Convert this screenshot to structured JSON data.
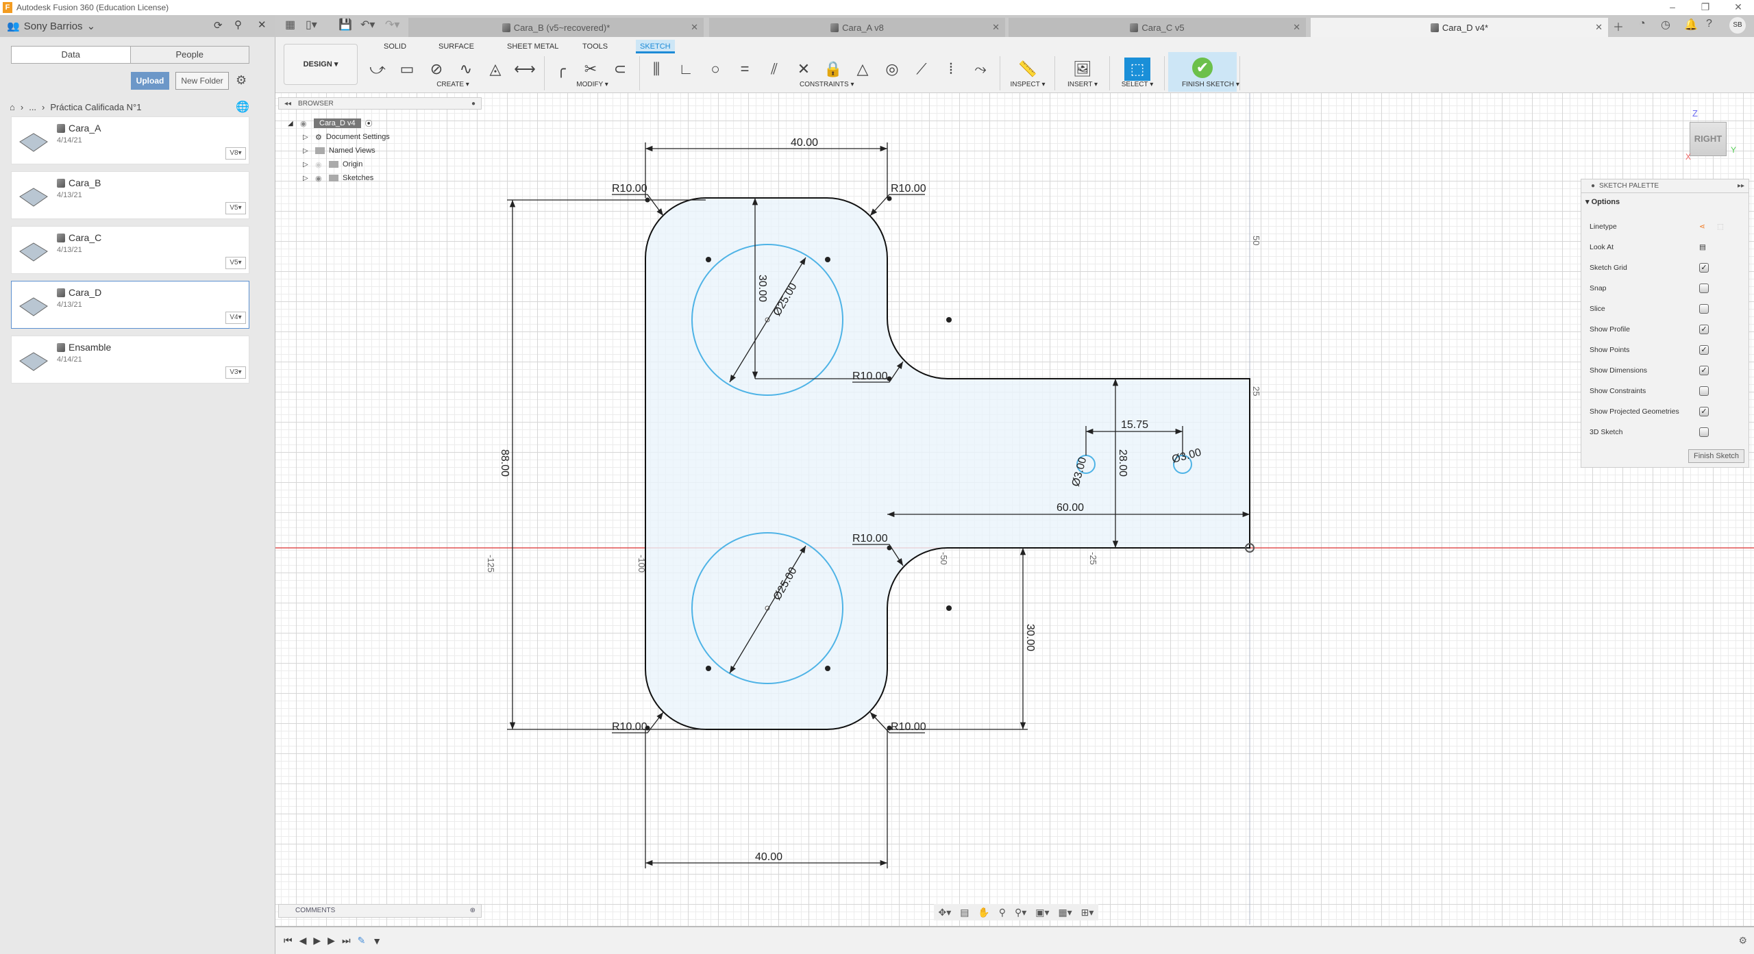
{
  "window": {
    "title": "Autodesk Fusion 360 (Education License)",
    "logo": "F",
    "controls": [
      "–",
      "❐",
      "✕"
    ]
  },
  "data_panel": {
    "user": "Sony Barrios",
    "toggle": [
      "Data",
      "People"
    ],
    "upload": "Upload",
    "new_folder": "New Folder",
    "breadcrumb": {
      "ellipsis": "...",
      "project": "Práctica Calificada N°1"
    },
    "files": [
      {
        "name": "Cara_A",
        "date": "4/14/21",
        "version": "V8"
      },
      {
        "name": "Cara_B",
        "date": "4/13/21",
        "version": "V5"
      },
      {
        "name": "Cara_C",
        "date": "4/13/21",
        "version": "V5"
      },
      {
        "name": "Cara_D",
        "date": "4/13/21",
        "version": "V4",
        "selected": true
      },
      {
        "name": "Ensamble",
        "date": "4/14/21",
        "version": "V3"
      }
    ]
  },
  "doc_tabs": [
    {
      "label": "Cara_B (v5~recovered)*"
    },
    {
      "label": "Cara_A v8"
    },
    {
      "label": "Cara_C v5"
    },
    {
      "label": "Cara_D v4*",
      "active": true
    }
  ],
  "user_initials": "SB",
  "ribbon": {
    "tabs": [
      "SOLID",
      "SURFACE",
      "SHEET METAL",
      "TOOLS",
      "SKETCH"
    ],
    "active_tab": "SKETCH",
    "workspace": "DESIGN ▾",
    "groups": [
      {
        "label": "CREATE ▾",
        "tools": [
          {
            "icon": "line-icon",
            "g": "⤻"
          },
          {
            "icon": "rectangle-icon",
            "g": "▭"
          },
          {
            "icon": "circle-icon",
            "g": "⊘"
          },
          {
            "icon": "spline-icon",
            "g": "∿"
          },
          {
            "icon": "mirror-icon",
            "g": "◬"
          },
          {
            "icon": "sketch-dimension-icon",
            "g": "⟷"
          }
        ]
      },
      {
        "label": "MODIFY ▾",
        "tools": [
          {
            "icon": "fillet-icon",
            "g": "╭"
          },
          {
            "icon": "trim-icon",
            "g": "✂"
          },
          {
            "icon": "offset-icon",
            "g": "⊂"
          }
        ]
      },
      {
        "label": "CONSTRAINTS ▾",
        "tools": [
          {
            "icon": "fix-icon",
            "g": "⫼"
          },
          {
            "icon": "coincident-icon",
            "g": "∟"
          },
          {
            "icon": "tangent-icon",
            "g": "○"
          },
          {
            "icon": "equal-icon",
            "g": "="
          },
          {
            "icon": "parallel-icon",
            "g": "⫽"
          },
          {
            "icon": "perpendicular-icon",
            "g": "✕"
          },
          {
            "icon": "lock-icon",
            "g": "🔒"
          },
          {
            "icon": "triangle-icon",
            "g": "△"
          },
          {
            "icon": "concentric-icon",
            "g": "◎"
          },
          {
            "icon": "midpoint-icon",
            "g": "⟋"
          },
          {
            "icon": "symmetry-icon",
            "g": "⦙"
          },
          {
            "icon": "curvature-icon",
            "g": "⤳"
          }
        ]
      },
      {
        "label": "INSPECT ▾",
        "tools": [
          {
            "icon": "measure-icon",
            "g": "📏"
          }
        ]
      },
      {
        "label": "INSERT ▾",
        "tools": [
          {
            "icon": "insert-image-icon",
            "g": "🖼"
          }
        ]
      },
      {
        "label": "SELECT ▾",
        "tools": [
          {
            "icon": "select-icon",
            "g": "⬚"
          }
        ]
      },
      {
        "label": "FINISH SKETCH ▾",
        "tools": [
          {
            "icon": "finish-sketch-check-icon",
            "g": "✔"
          }
        ]
      }
    ]
  },
  "browser": {
    "title": "BROWSER",
    "root": "Cara_D v4",
    "items": [
      "Document Settings",
      "Named Views",
      "Origin",
      "Sketches"
    ]
  },
  "palette": {
    "title": "SKETCH PALETTE",
    "section": "Options",
    "linetype": "Linetype",
    "look_at": "Look At",
    "options": [
      {
        "label": "Sketch Grid",
        "checked": true
      },
      {
        "label": "Snap",
        "checked": false
      },
      {
        "label": "Slice",
        "checked": false
      },
      {
        "label": "Show Profile",
        "checked": true
      },
      {
        "label": "Show Points",
        "checked": true
      },
      {
        "label": "Show Dimensions",
        "checked": true
      },
      {
        "label": "Show Constraints",
        "checked": false
      },
      {
        "label": "Show Projected Geometries",
        "checked": true
      },
      {
        "label": "3D Sketch",
        "checked": false
      }
    ],
    "finish": "Finish Sketch"
  },
  "viewcube": {
    "face": "RIGHT",
    "z": "Z",
    "x": "X",
    "y": "Y"
  },
  "comments": "COMMENTS",
  "sketch": {
    "dimensions": {
      "top_width": "40.00",
      "bottom_width": "40.00",
      "height": "88.00",
      "upper_offset": "30.00",
      "lower_offset": "30.00",
      "upper_dia": "Ø25.00",
      "lower_dia": "Ø25.00",
      "hole_spacing": "15.75",
      "arm_height": "28.00",
      "arm_length": "60.00",
      "small_hole_1": "Ø3.00",
      "small_hole_2": "Ø3.00",
      "radius": "R10.00"
    },
    "axis_labels": {
      "m125": "-125",
      "m100": "-100",
      "m50": "-50",
      "m25": "-25",
      "p25": "25",
      "p50": "50"
    },
    "colors": {
      "profile": "#eaf4fb",
      "circle": "#4eb3e6",
      "x_axis": "#e05050"
    }
  }
}
